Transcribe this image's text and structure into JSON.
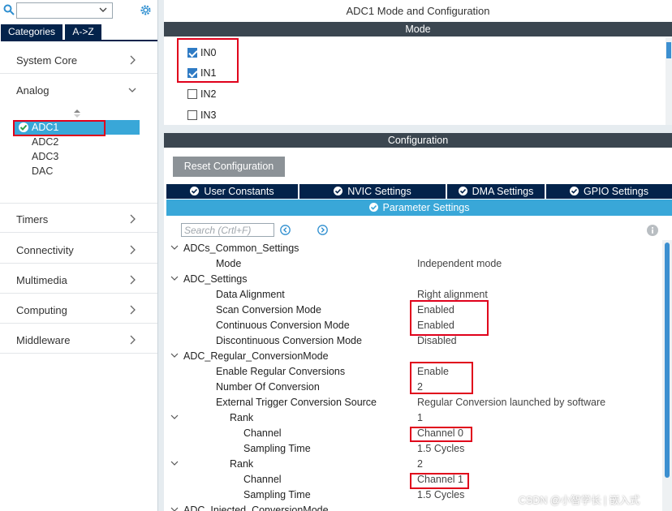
{
  "left": {
    "tabs": {
      "categories": "Categories",
      "az": "A->Z"
    },
    "categories": [
      {
        "label": "System Core"
      },
      {
        "label": "Analog"
      },
      {
        "label": "Timers"
      },
      {
        "label": "Connectivity"
      },
      {
        "label": "Multimedia"
      },
      {
        "label": "Computing"
      },
      {
        "label": "Middleware"
      }
    ],
    "analog_items": [
      "ADC1",
      "ADC2",
      "ADC3",
      "DAC"
    ]
  },
  "right": {
    "title": "ADC1 Mode and Configuration",
    "mode_bar": "Mode",
    "mode_items": [
      {
        "label": "IN0",
        "checked": true
      },
      {
        "label": "IN1",
        "checked": true
      },
      {
        "label": "IN2",
        "checked": false
      },
      {
        "label": "IN3",
        "checked": false
      }
    ],
    "config_bar": "Configuration",
    "reset_button": "Reset Configuration",
    "settings_tabs": [
      "User Constants",
      "NVIC Settings",
      "DMA Settings",
      "GPIO Settings"
    ],
    "parameter_tab": "Parameter Settings",
    "search_placeholder": "Search (Crtl+F)",
    "tree": [
      {
        "key": "ADCs_Common_Settings",
        "value": ""
      },
      {
        "key": "Mode",
        "value": "Independent mode"
      },
      {
        "key": "ADC_Settings",
        "value": ""
      },
      {
        "key": "Data Alignment",
        "value": "Right alignment"
      },
      {
        "key": "Scan Conversion Mode",
        "value": "Enabled"
      },
      {
        "key": "Continuous Conversion Mode",
        "value": "Enabled"
      },
      {
        "key": "Discontinuous Conversion Mode",
        "value": "Disabled"
      },
      {
        "key": "ADC_Regular_ConversionMode",
        "value": ""
      },
      {
        "key": "Enable Regular Conversions",
        "value": "Enable"
      },
      {
        "key": "Number Of Conversion",
        "value": "2"
      },
      {
        "key": "External Trigger Conversion Source",
        "value": "Regular Conversion launched by software"
      },
      {
        "key": "Rank",
        "value": "1"
      },
      {
        "key": "Channel",
        "value": "Channel 0"
      },
      {
        "key": "Sampling Time",
        "value": "1.5 Cycles"
      },
      {
        "key": "Rank",
        "value": "2"
      },
      {
        "key": "Channel",
        "value": "Channel 1"
      },
      {
        "key": "Sampling Time",
        "value": "1.5 Cycles"
      },
      {
        "key": "ADC_Injected_ConversionMode",
        "value": ""
      }
    ]
  },
  "watermark": "CSDN @小智学长 | 嵌入式",
  "colors": {
    "navy": "#03234b",
    "selected": "#39a7d8",
    "highlight": "#e0001b",
    "bar": "#3b4650"
  }
}
